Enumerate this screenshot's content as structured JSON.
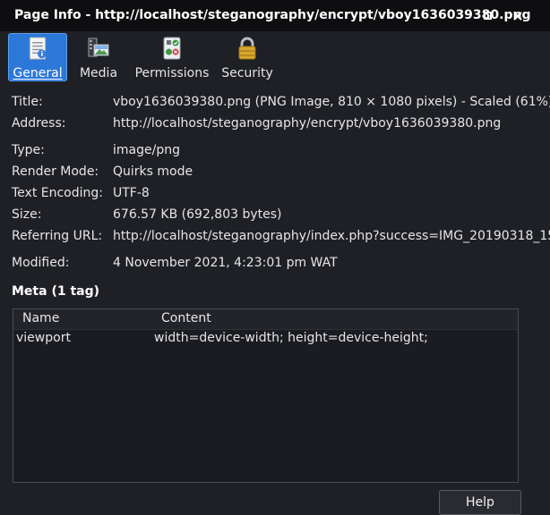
{
  "window": {
    "title": "Page Info - http://localhost/steganography/encrypt/vboy1636039380.png"
  },
  "tabs": [
    {
      "label": "General",
      "icon": "document-info-icon",
      "active": true
    },
    {
      "label": "Media",
      "icon": "media-icon",
      "active": false
    },
    {
      "label": "Permissions",
      "icon": "permissions-icon",
      "active": false
    },
    {
      "label": "Security",
      "icon": "lock-icon",
      "active": false
    }
  ],
  "general": {
    "title_label": "Title:",
    "title_value": "vboy1636039380.png (PNG Image, 810 × 1080 pixels) - Scaled (61%)",
    "address_label": "Address:",
    "address_value": "http://localhost/steganography/encrypt/vboy1636039380.png",
    "type_label": "Type:",
    "type_value": "image/png",
    "render_label": "Render Mode:",
    "render_value": "Quirks mode",
    "encoding_label": "Text Encoding:",
    "encoding_value": "UTF-8",
    "size_label": "Size:",
    "size_value": "676.57 KB (692,803 bytes)",
    "referring_label": "Referring URL:",
    "referring_value": "http://localhost/steganography/index.php?success=IMG_20190318_15",
    "modified_label": "Modified:",
    "modified_value": "4 November 2021, 4:23:01 pm WAT"
  },
  "meta": {
    "heading": "Meta (1 tag)",
    "columns": {
      "name": "Name",
      "content": "Content"
    },
    "rows": [
      {
        "name": "viewport",
        "content": "width=device-width; height=device-height;"
      }
    ]
  },
  "buttons": {
    "help": "Help"
  },
  "colors": {
    "accent": "#2b78d8",
    "titlebar": "#0e0e11",
    "background": "#1f2025"
  }
}
